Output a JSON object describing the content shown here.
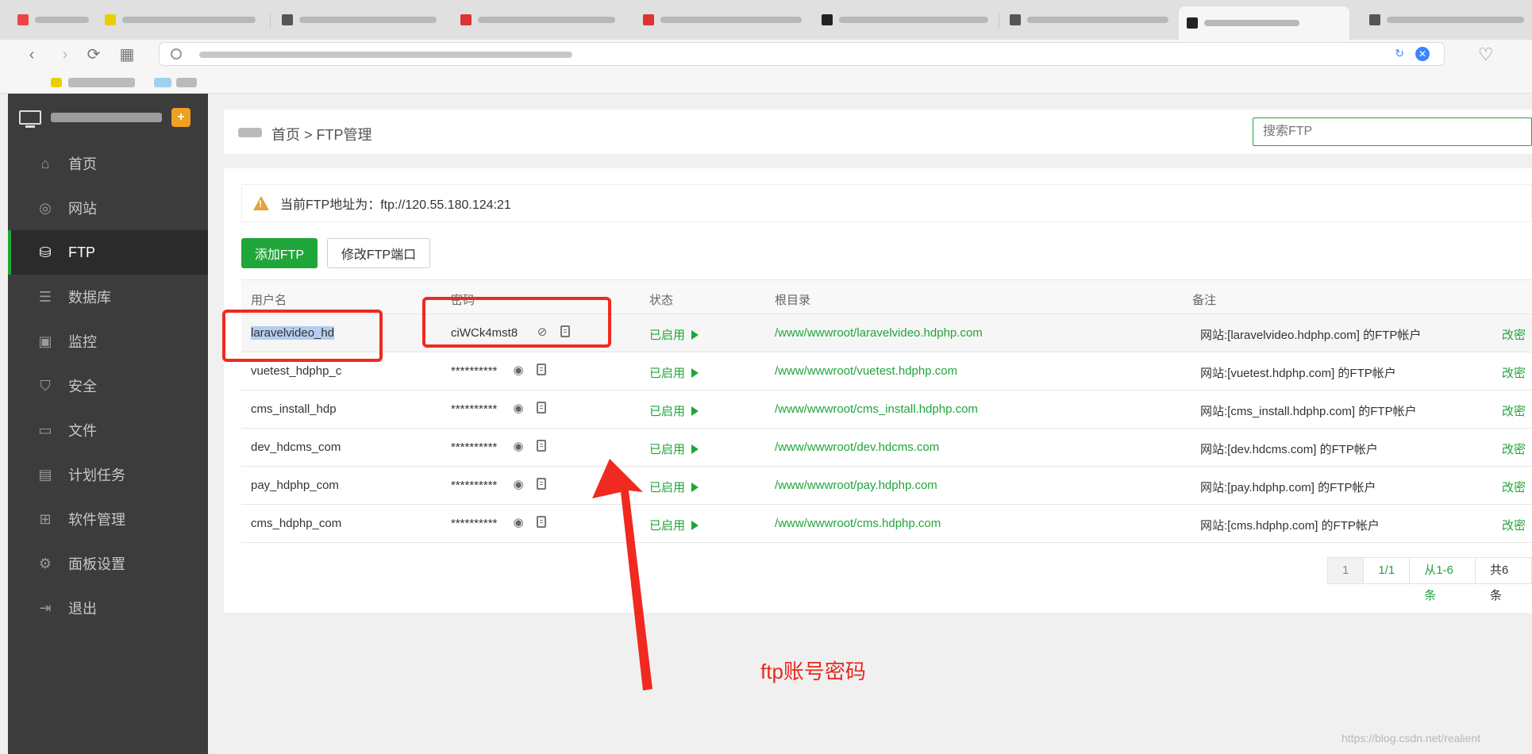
{
  "sidebar": {
    "items": [
      {
        "label": "首页",
        "icon": "home-icon"
      },
      {
        "label": "网站",
        "icon": "globe-icon"
      },
      {
        "label": "FTP",
        "icon": "ftp-icon"
      },
      {
        "label": "数据库",
        "icon": "database-icon"
      },
      {
        "label": "监控",
        "icon": "monitor-icon"
      },
      {
        "label": "安全",
        "icon": "shield-icon"
      },
      {
        "label": "文件",
        "icon": "folder-icon"
      },
      {
        "label": "计划任务",
        "icon": "calendar-icon"
      },
      {
        "label": "软件管理",
        "icon": "apps-icon"
      },
      {
        "label": "面板设置",
        "icon": "gear-icon"
      },
      {
        "label": "退出",
        "icon": "logout-icon"
      }
    ],
    "active": "FTP"
  },
  "header": {
    "breadcrumb": "首页 > FTP管理",
    "search_placeholder": "搜索FTP"
  },
  "notice": {
    "text": "当前FTP地址为：ftp://120.55.180.124:21"
  },
  "actions": {
    "add_label": "添加FTP",
    "port_label": "修改FTP端口"
  },
  "table": {
    "columns": [
      "用户名",
      "密码",
      "状态",
      "根目录",
      "备注"
    ],
    "rows": [
      {
        "user": "laravelvideo_hd",
        "password": "ciWCk4mst8",
        "status": "已启用",
        "root": "/www/wwwroot/laravelvideo.hdphp.com",
        "note": "网站:[laravelvideo.hdphp.com] 的FTP帐户",
        "op": "改密"
      },
      {
        "user": "vuetest_hdphp_c",
        "password": "**********",
        "status": "已启用",
        "root": "/www/wwwroot/vuetest.hdphp.com",
        "note": "网站:[vuetest.hdphp.com] 的FTP帐户",
        "op": "改密"
      },
      {
        "user": "cms_install_hdp",
        "password": "**********",
        "status": "已启用",
        "root": "/www/wwwroot/cms_install.hdphp.com",
        "note": "网站:[cms_install.hdphp.com] 的FTP帐户",
        "op": "改密"
      },
      {
        "user": "dev_hdcms_com",
        "password": "**********",
        "status": "已启用",
        "root": "/www/wwwroot/dev.hdcms.com",
        "note": "网站:[dev.hdcms.com] 的FTP帐户",
        "op": "改密"
      },
      {
        "user": "pay_hdphp_com",
        "password": "**********",
        "status": "已启用",
        "root": "/www/wwwroot/pay.hdphp.com",
        "note": "网站:[pay.hdphp.com] 的FTP帐户",
        "op": "改密"
      },
      {
        "user": "cms_hdphp_com",
        "password": "**********",
        "status": "已启用",
        "root": "/www/wwwroot/cms.hdphp.com",
        "note": "网站:[cms.hdphp.com] 的FTP帐户",
        "op": "改密"
      }
    ]
  },
  "pager": {
    "current": "1",
    "pages": "1/1",
    "range": "从1-6条",
    "total": "共6条"
  },
  "annotation": {
    "text": "ftp账号密码",
    "color": "#f02a20"
  },
  "watermark": "https://blog.csdn.net/realient",
  "colors": {
    "accent": "#20a53a",
    "sidebar_bg": "#3c3c3c",
    "warning": "#e6a23c"
  }
}
